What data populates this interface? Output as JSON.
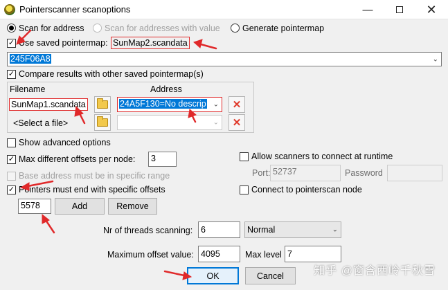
{
  "window": {
    "title": "Pointerscanner scanoptions"
  },
  "modes": {
    "scan_for_address": "Scan for address",
    "scan_with_value": "Scan for addresses with value",
    "generate_pointermap": "Generate pointermap"
  },
  "saved_pointermap": {
    "label": "Use saved pointermap:",
    "file": "SunMap2.scandata"
  },
  "address_combo": {
    "value": "245F06A8"
  },
  "compare": {
    "label": "Compare results with other saved pointermap(s)",
    "col_filename": "Filename",
    "col_address": "Address",
    "rows": [
      {
        "filename": "SunMap1.scandata",
        "address": "24A5F130=No descrip"
      },
      {
        "filename": "<Select a file>",
        "address": ""
      }
    ]
  },
  "show_advanced": "Show advanced options",
  "max_offsets": {
    "label": "Max different offsets per node:",
    "value": "3"
  },
  "base_range": "Base address must be in specific range",
  "end_offsets": {
    "label": "Pointers must end with specific offsets",
    "value": "5578"
  },
  "buttons": {
    "add": "Add",
    "remove": "Remove",
    "ok": "OK",
    "cancel": "Cancel"
  },
  "runtime": {
    "allow_label": "Allow scanners to connect at runtime",
    "port_label": "Port:",
    "port_value": "52737",
    "password_label": "Password",
    "connect_label": "Connect to pointerscan node"
  },
  "threads": {
    "label": "Nr of threads scanning:",
    "value": "6",
    "priority": "Normal"
  },
  "max_offset": {
    "label": "Maximum offset value:",
    "value": "4095"
  },
  "max_level": {
    "label": "Max level",
    "value": "7"
  },
  "watermark": "知乎 @窗含西岭千秋雪"
}
